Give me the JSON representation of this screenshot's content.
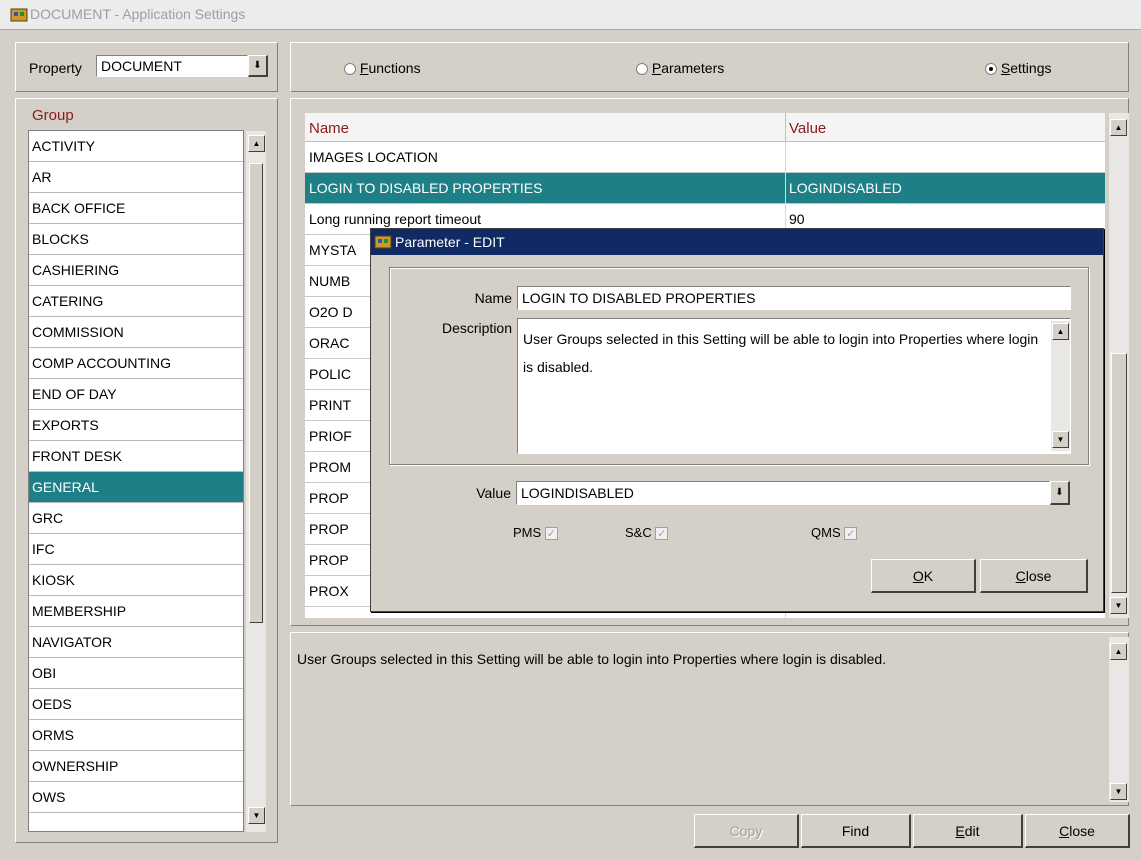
{
  "window": {
    "title": "DOCUMENT - Application Settings",
    "icon": "app-icon"
  },
  "property": {
    "label": "Property",
    "value": "DOCUMENT"
  },
  "mode": {
    "options": [
      {
        "label": "Functions",
        "accel": "F",
        "rest": "unctions",
        "selected": false
      },
      {
        "label": "Parameters",
        "accel": "P",
        "rest": "arameters",
        "selected": false
      },
      {
        "label": "Settings",
        "accel": "S",
        "rest": "ettings",
        "selected": true
      }
    ]
  },
  "group": {
    "header": "Group",
    "items": [
      "ACTIVITY",
      "AR",
      "BACK OFFICE",
      "BLOCKS",
      "CASHIERING",
      "CATERING",
      "COMMISSION",
      "COMP ACCOUNTING",
      "END OF DAY",
      "EXPORTS",
      "FRONT DESK",
      "GENERAL",
      "GRC",
      "IFC",
      "KIOSK",
      "MEMBERSHIP",
      "NAVIGATOR",
      "OBI",
      "OEDS",
      "ORMS",
      "OWNERSHIP",
      "OWS"
    ],
    "selected": "GENERAL"
  },
  "grid": {
    "headers": {
      "name": "Name",
      "value": "Value"
    },
    "rows": [
      {
        "name": "IMAGES LOCATION",
        "value": ""
      },
      {
        "name": "LOGIN TO DISABLED PROPERTIES",
        "value": "LOGINDISABLED",
        "selected": true
      },
      {
        "name": "Long running report timeout",
        "value": "90"
      },
      {
        "name": "MYSTA",
        "value": ""
      },
      {
        "name": "NUMB",
        "value": ""
      },
      {
        "name": "O2O D",
        "value": ""
      },
      {
        "name": "ORAC",
        "value": ""
      },
      {
        "name": "POLIC",
        "value": ""
      },
      {
        "name": "PRINT",
        "value": ""
      },
      {
        "name": "PRIOF",
        "value": ""
      },
      {
        "name": "PROM",
        "value": ""
      },
      {
        "name": "PROP",
        "value": ""
      },
      {
        "name": "PROP",
        "value": ""
      },
      {
        "name": "PROP",
        "value": ""
      },
      {
        "name": "PROX",
        "value": ""
      }
    ]
  },
  "description_panel": {
    "text": "User Groups selected in this Setting will be able to login into Properties where login is disabled."
  },
  "buttons": {
    "copy": {
      "label": "Copy"
    },
    "find": {
      "label": "Find"
    },
    "edit": {
      "label": "Edit",
      "accel": "E",
      "rest": "dit"
    },
    "close": {
      "label": "Close",
      "accel": "C",
      "rest": "lose"
    }
  },
  "dialog": {
    "title": "Parameter - EDIT",
    "name_label": "Name",
    "name_value": "LOGIN TO DISABLED PROPERTIES",
    "description_label": "Description",
    "description_value": "User Groups selected in this Setting will be able to login into Properties where login is disabled.",
    "value_label": "Value",
    "value_value": "LOGINDISABLED",
    "checkboxes": [
      {
        "label": "PMS",
        "checked": true
      },
      {
        "label": "S&C",
        "checked": true
      },
      {
        "label": "QMS",
        "checked": true
      }
    ],
    "ok": {
      "label": "OK",
      "accel": "O",
      "rest": "K"
    },
    "close": {
      "label": "Close",
      "accel": "C",
      "rest": "lose"
    }
  },
  "colors": {
    "selection": "#1e7f86",
    "dialog_title": "#102a63",
    "column_header": "#8b1a1a"
  }
}
